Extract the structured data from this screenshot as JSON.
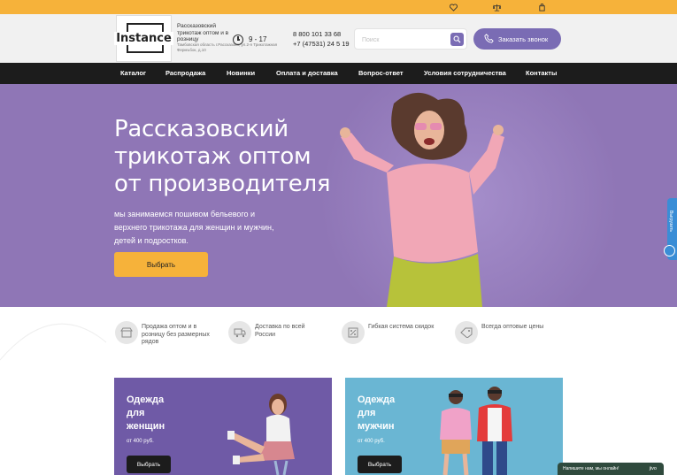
{
  "topbar": {
    "icons": [
      "heart-icon",
      "scales-icon",
      "bag-icon"
    ]
  },
  "header": {
    "logo_text": "Instance",
    "description": "Рассказовский трикотаж оптом и в розницу",
    "address": "Тамбовская область г.Рассказово, ул.2-я Трикотажная Фермъбок, д.10",
    "hours": "9 - 17",
    "phones": [
      "8 800 101 33 68",
      "+7 (47531) 24 5 19"
    ],
    "search_placeholder": "Поиск",
    "callback_label": "Заказать звонок"
  },
  "nav": {
    "items": [
      "Каталог",
      "Распродажа",
      "Новинки",
      "Оплата и доставка",
      "Вопрос-ответ",
      "Условия сотрудничества",
      "Контакты"
    ]
  },
  "hero": {
    "title": "Рассказовский трикотаж оптом от производителя",
    "subtitle": "мы занимаемся пошивом бельевого и верхнего трикотажа для женщин и мужчин, детей и подростков.",
    "button": "Выбрать"
  },
  "features": [
    {
      "label": "Продажа оптом и в розницу без размерных рядов",
      "icon": "store-icon"
    },
    {
      "label": "Доставка по всей России",
      "icon": "truck-icon"
    },
    {
      "label": "Гибкая система скидок",
      "icon": "discount-icon"
    },
    {
      "label": "Всегда оптовые цены",
      "icon": "price-icon"
    }
  ],
  "cards": [
    {
      "title": "Одежда для женщин",
      "price": "от 400 руб.",
      "button": "Выбрать"
    },
    {
      "title": "Одежда для мужчин",
      "price": "от 400 руб.",
      "button": "Выбрать"
    }
  ],
  "side_tab": {
    "label": "Выгрузить"
  },
  "chat": {
    "label": "Напишите нам, мы онлайн!",
    "brand": "jivo"
  },
  "colors": {
    "accent": "#f6b23a",
    "brand": "#7a6cb4",
    "hero_bg": "#8f76b6",
    "nav_bg": "#1c1c1c"
  }
}
